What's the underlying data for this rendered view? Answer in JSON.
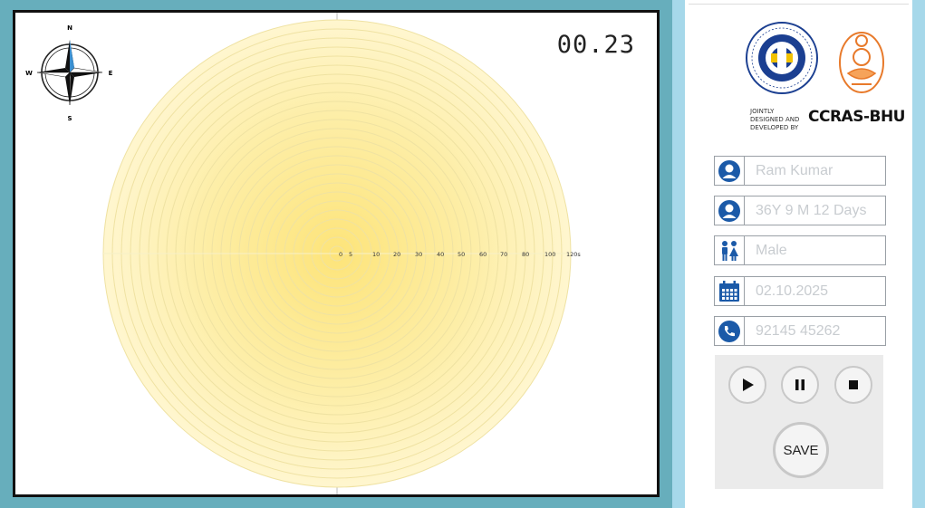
{
  "timer": {
    "value": "00.23"
  },
  "compass": {
    "n": "N",
    "s": "S",
    "e": "E",
    "w": "W"
  },
  "target": {
    "scale_labels": [
      "0",
      "5",
      "10",
      "20",
      "30",
      "40",
      "50",
      "60",
      "70",
      "80",
      "100",
      "120s"
    ],
    "ring_fill_outer": "#fff7cc",
    "ring_fill_inner": "#fde98a",
    "ring_stroke": "#efe2a2"
  },
  "branding": {
    "credit_line": "JOINTLY DESIGNED AND DEVELOPED BY",
    "brand": "CCRAS-BHU"
  },
  "fields": {
    "name": {
      "placeholder": "Ram Kumar"
    },
    "age": {
      "placeholder": "36Y 9 M 12 Days"
    },
    "gender": {
      "placeholder": "Male"
    },
    "date": {
      "placeholder": "02.10.2025"
    },
    "phone": {
      "placeholder": "92145 45262"
    }
  },
  "icons": {
    "name": "user-icon",
    "age": "user-icon",
    "gender": "gender-icon",
    "date": "calendar-icon",
    "phone": "phone-icon",
    "color": "#1b5aa8"
  },
  "controls": {
    "save_label": "SAVE"
  }
}
